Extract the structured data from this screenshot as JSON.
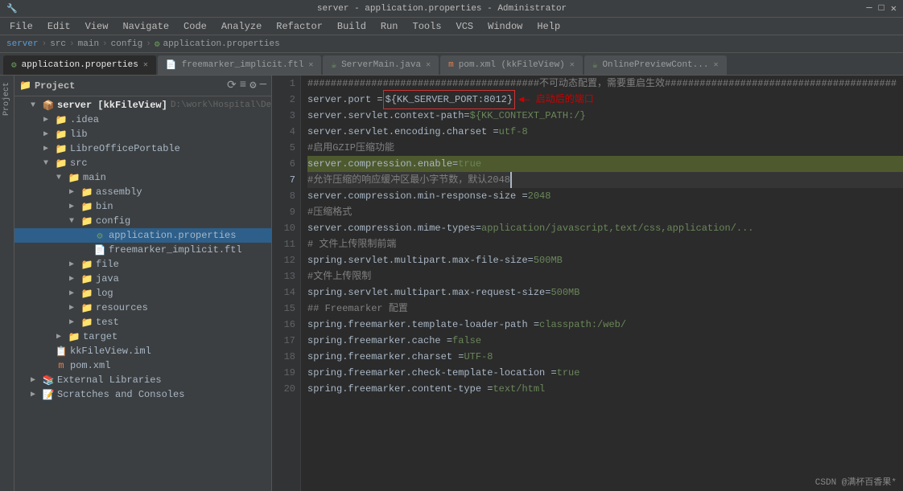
{
  "titleBar": {
    "text": "server - application.properties - Administrator"
  },
  "menuBar": {
    "items": [
      "File",
      "Edit",
      "View",
      "Navigate",
      "Code",
      "Analyze",
      "Refactor",
      "Build",
      "Run",
      "Tools",
      "VCS",
      "Window",
      "Help"
    ]
  },
  "breadcrumb": {
    "items": [
      "server",
      "src",
      "main",
      "config",
      "application.properties"
    ]
  },
  "tabs": [
    {
      "id": "props",
      "label": "application.properties",
      "icon": "gear",
      "active": true,
      "closeable": true
    },
    {
      "id": "ftl",
      "label": "freemarker_implicit.ftl",
      "icon": "ftl",
      "active": false,
      "closeable": true
    },
    {
      "id": "java",
      "label": "ServerMain.java",
      "icon": "java",
      "active": false,
      "closeable": true
    },
    {
      "id": "pom",
      "label": "pom.xml (kkFileView)",
      "icon": "xml",
      "active": false,
      "closeable": true
    },
    {
      "id": "online",
      "label": "OnlinePreviewCont...",
      "icon": "java",
      "active": false,
      "closeable": true
    }
  ],
  "sidebar": {
    "title": "Project",
    "tree": [
      {
        "id": "server",
        "indent": 0,
        "arrow": "▼",
        "icon": "module",
        "label": "server [kkFileView]",
        "note": "D:\\work\\Hospital\\Dem",
        "bold": true
      },
      {
        "id": "idea",
        "indent": 1,
        "arrow": "▶",
        "icon": "folder-hidden",
        "label": ".idea"
      },
      {
        "id": "lib",
        "indent": 1,
        "arrow": "▶",
        "icon": "folder",
        "label": "lib"
      },
      {
        "id": "libre",
        "indent": 1,
        "arrow": "▶",
        "icon": "folder",
        "label": "LibreOfficePortable"
      },
      {
        "id": "src",
        "indent": 1,
        "arrow": "▼",
        "icon": "folder-src",
        "label": "src"
      },
      {
        "id": "main",
        "indent": 2,
        "arrow": "▼",
        "icon": "folder-main",
        "label": "main"
      },
      {
        "id": "assembly",
        "indent": 3,
        "arrow": "▶",
        "icon": "folder",
        "label": "assembly"
      },
      {
        "id": "bin",
        "indent": 3,
        "arrow": "▶",
        "icon": "folder",
        "label": "bin"
      },
      {
        "id": "config",
        "indent": 3,
        "arrow": "▼",
        "icon": "folder-config",
        "label": "config"
      },
      {
        "id": "app-props",
        "indent": 4,
        "arrow": "",
        "icon": "gear",
        "label": "application.properties",
        "selected": true
      },
      {
        "id": "ftl-file",
        "indent": 4,
        "arrow": "",
        "icon": "ftl",
        "label": "freemarker_implicit.ftl"
      },
      {
        "id": "file",
        "indent": 3,
        "arrow": "▶",
        "icon": "folder",
        "label": "file"
      },
      {
        "id": "java-dir",
        "indent": 3,
        "arrow": "▶",
        "icon": "folder-java",
        "label": "java"
      },
      {
        "id": "log",
        "indent": 3,
        "arrow": "▶",
        "icon": "folder",
        "label": "log"
      },
      {
        "id": "resources",
        "indent": 3,
        "arrow": "▶",
        "icon": "folder-res",
        "label": "resources"
      },
      {
        "id": "test",
        "indent": 3,
        "arrow": "▶",
        "icon": "folder",
        "label": "test"
      },
      {
        "id": "target",
        "indent": 2,
        "arrow": "▶",
        "icon": "folder-target",
        "label": "target"
      },
      {
        "id": "iml",
        "indent": 1,
        "arrow": "",
        "icon": "iml",
        "label": "kkFileView.iml"
      },
      {
        "id": "pom-xml",
        "indent": 1,
        "arrow": "",
        "icon": "xml",
        "label": "pom.xml"
      },
      {
        "id": "ext-libs",
        "indent": 0,
        "arrow": "▶",
        "icon": "libs",
        "label": "External Libraries"
      },
      {
        "id": "scratches",
        "indent": 0,
        "arrow": "▶",
        "icon": "scratches",
        "label": "Scratches and Consoles"
      }
    ]
  },
  "editor": {
    "lines": [
      {
        "num": 1,
        "content": "########################################不可动态配置，需要重启生效########################################",
        "type": "comment"
      },
      {
        "num": 2,
        "content": "server.port = ${KK_SERVER_PORT:8012}",
        "type": "mixed",
        "annotation": "启动后的端口"
      },
      {
        "num": 3,
        "content": "server.servlet.context-path= ${KK_CONTEXT_PATH:/}",
        "type": "mixed"
      },
      {
        "num": 4,
        "content": "server.servlet.encoding.charset = utf-8",
        "type": "plain"
      },
      {
        "num": 5,
        "content": "#启用GZIP压缩功能",
        "type": "comment"
      },
      {
        "num": 6,
        "content": "server.compression.enable= true",
        "type": "highlighted"
      },
      {
        "num": 7,
        "content": "#允许压缩的响应缓冲区最小字节数，默认2048",
        "type": "comment-cursor"
      },
      {
        "num": 8,
        "content": "server.compression.min-response-size = 2048",
        "type": "plain"
      },
      {
        "num": 9,
        "content": "#压缩格式",
        "type": "comment"
      },
      {
        "num": 10,
        "content": "server.compression.mime-types=application/javascript,text/css,application/...",
        "type": "plain"
      },
      {
        "num": 11,
        "content": "# 文件上传限制前端",
        "type": "comment"
      },
      {
        "num": 12,
        "content": "spring.servlet.multipart.max-file-size=500MB",
        "type": "plain"
      },
      {
        "num": 13,
        "content": "#文件上传限制",
        "type": "comment"
      },
      {
        "num": 14,
        "content": "spring.servlet.multipart.max-request-size=500MB",
        "type": "plain"
      },
      {
        "num": 15,
        "content": "## Freemarker 配置",
        "type": "comment"
      },
      {
        "num": 16,
        "content": "spring.freemarker.template-loader-path = classpath:/web/",
        "type": "plain"
      },
      {
        "num": 17,
        "content": "spring.freemarker.cache = false",
        "type": "plain"
      },
      {
        "num": 18,
        "content": "spring.freemarker.charset = UTF-8",
        "type": "plain"
      },
      {
        "num": 19,
        "content": "spring.freemarker.check-template-location = true",
        "type": "plain"
      },
      {
        "num": 20,
        "content": "spring.freemarker.content-type = text/html",
        "type": "plain"
      }
    ]
  },
  "watermark": "CSDN @满杯百香果*",
  "projectLabel": "Project",
  "leftStrip": {
    "label": "Project"
  }
}
